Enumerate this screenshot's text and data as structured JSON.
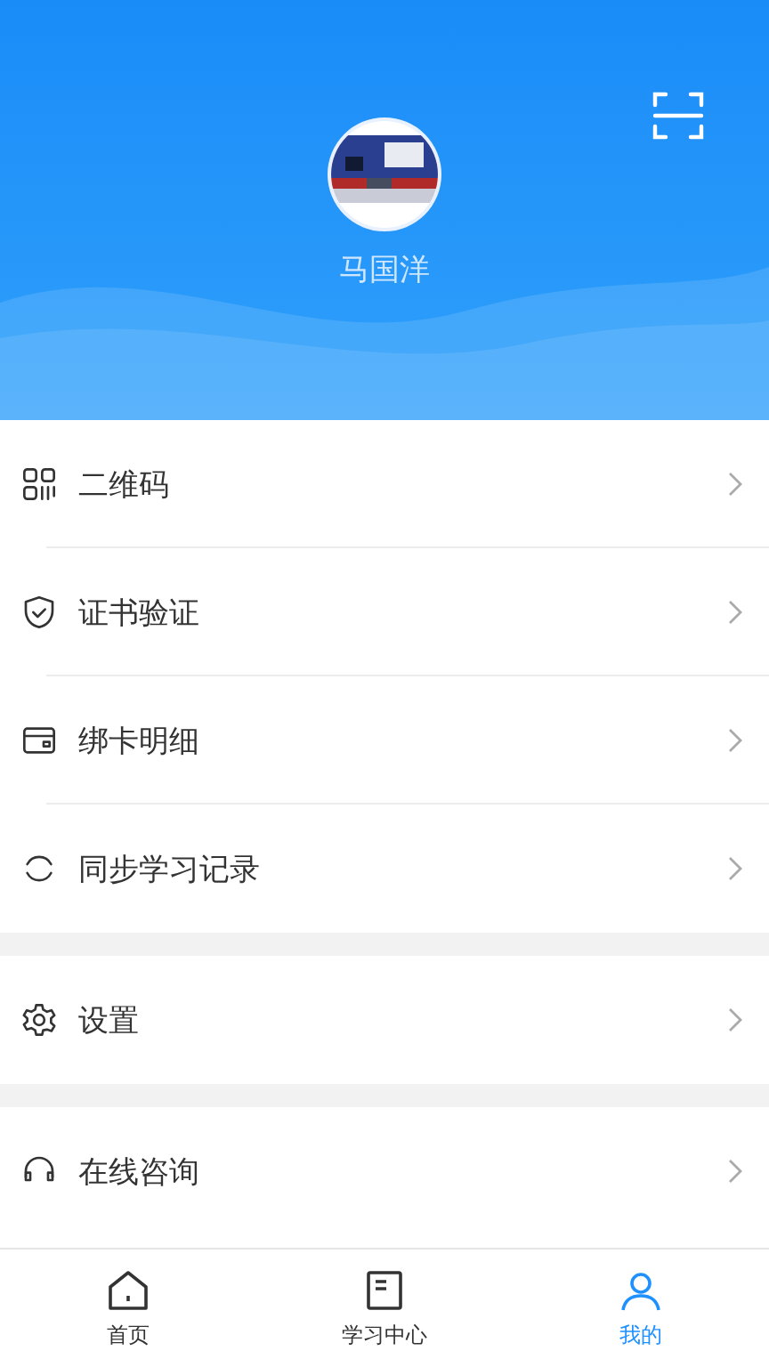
{
  "profile": {
    "name": "马国洋"
  },
  "menu_groups": [
    {
      "items": [
        {
          "label": "二维码"
        },
        {
          "label": "证书验证"
        },
        {
          "label": "绑卡明细"
        },
        {
          "label": "同步学习记录"
        }
      ]
    },
    {
      "items": [
        {
          "label": "设置"
        }
      ]
    },
    {
      "items": [
        {
          "label": "在线咨询"
        }
      ]
    }
  ],
  "tabs": [
    {
      "label": "首页",
      "selected": false
    },
    {
      "label": "学习中心",
      "selected": false
    },
    {
      "label": "我的",
      "selected": true
    }
  ]
}
